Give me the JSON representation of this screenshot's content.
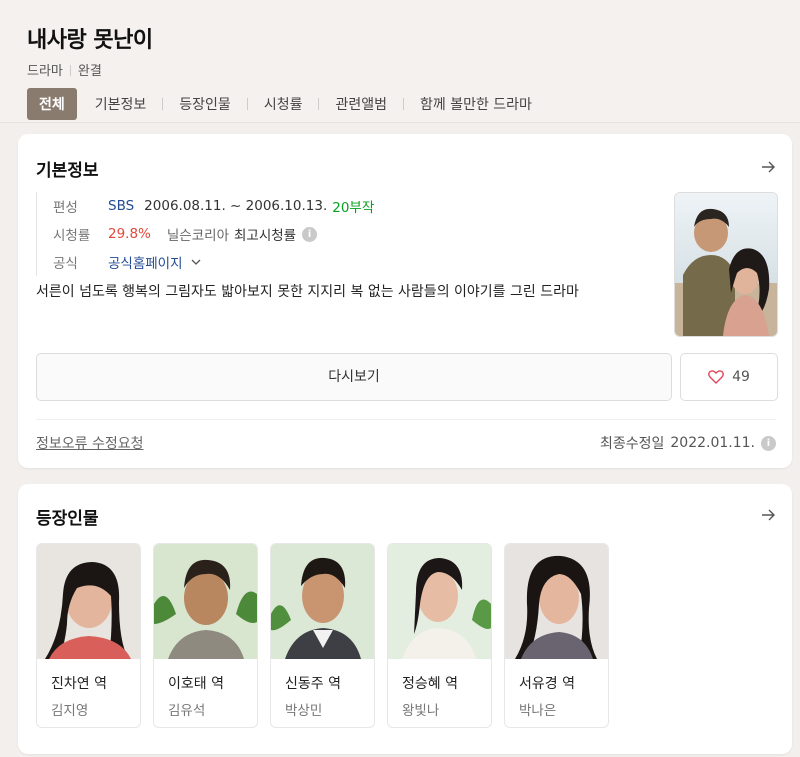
{
  "header": {
    "title": "내사랑 못난이",
    "genre": "드라마",
    "status": "완결",
    "tabs": [
      "전체",
      "기본정보",
      "등장인물",
      "시청률",
      "관련앨범",
      "함께 볼만한 드라마"
    ]
  },
  "basic_info": {
    "title": "기본정보",
    "broadcast_label": "편성",
    "channel": "SBS",
    "period": "2006.08.11. ~ 2006.10.13.",
    "episodes": "20부작",
    "rating_label": "시청률",
    "rating": "29.8%",
    "rating_source": "닐슨코리아",
    "rating_kind": "최고시청률",
    "official_label": "공식",
    "official_link": "공식홈페이지",
    "description": "서른이 넘도록 행복의 그림자도 밟아보지 못한 지지리 복 없는 사람들의 이야기를 그린 드라마",
    "rewatch_label": "다시보기",
    "like_count": "49",
    "report_label": "정보오류 수정요청",
    "updated_label": "최종수정일",
    "updated_date": "2022.01.11."
  },
  "cast": {
    "title": "등장인물",
    "members": [
      {
        "role": "진차연 역",
        "actor": "김지영"
      },
      {
        "role": "이호태 역",
        "actor": "김유석"
      },
      {
        "role": "신동주 역",
        "actor": "박상민"
      },
      {
        "role": "정승혜 역",
        "actor": "왕빛나"
      },
      {
        "role": "서유경 역",
        "actor": "박나은"
      }
    ]
  },
  "colors": {
    "active_tab": "#8a7b6f",
    "channel": "#234c94",
    "episodes": "#08a022",
    "rating": "#e04a3a"
  }
}
